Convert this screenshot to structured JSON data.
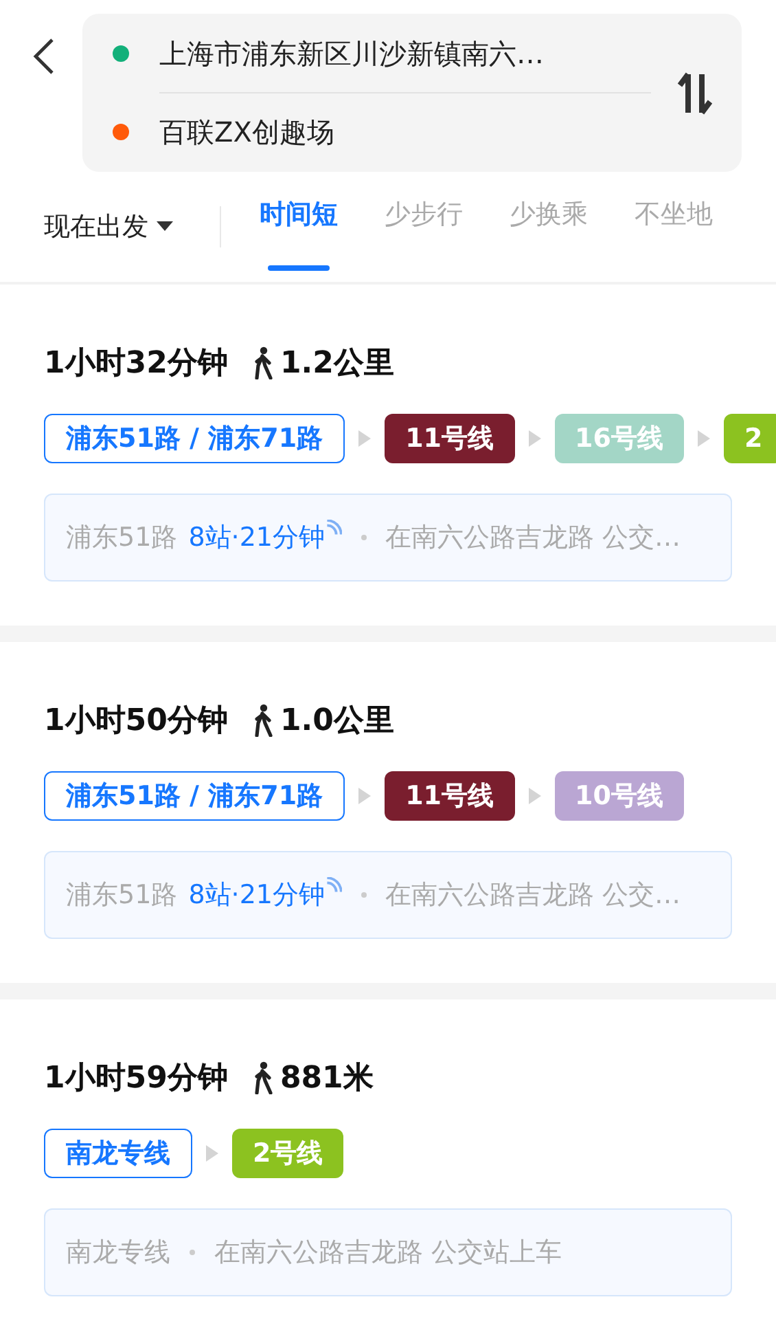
{
  "header": {
    "origin": "上海市浦东新区川沙新镇南六…",
    "destination": "百联ZX创趣场"
  },
  "departure": {
    "label": "现在出发"
  },
  "tabs": [
    {
      "label": "时间短",
      "selected": true
    },
    {
      "label": "少步行",
      "selected": false
    },
    {
      "label": "少换乘",
      "selected": false
    },
    {
      "label": "不坐地",
      "selected": false
    }
  ],
  "routes": [
    {
      "duration": "1小时32分钟",
      "walk": "1.2公里",
      "segments": [
        {
          "kind": "bus",
          "label": "浦东51路 / 浦东71路"
        },
        {
          "kind": "metro",
          "label": "11号线",
          "color": "#7a1e2e"
        },
        {
          "kind": "metro",
          "label": "16号线",
          "color": "#a3d6c6"
        },
        {
          "kind": "metro",
          "label": "2",
          "color": "#8cc220"
        }
      ],
      "detail": {
        "line": "浦东51路",
        "stops": "8站·21分钟",
        "realtime": true,
        "boarding": "在南六公路吉龙路 公交…"
      }
    },
    {
      "duration": "1小时50分钟",
      "walk": "1.0公里",
      "segments": [
        {
          "kind": "bus",
          "label": "浦东51路 / 浦东71路"
        },
        {
          "kind": "metro",
          "label": "11号线",
          "color": "#7a1e2e"
        },
        {
          "kind": "metro",
          "label": "10号线",
          "color": "#baa6d3"
        }
      ],
      "detail": {
        "line": "浦东51路",
        "stops": "8站·21分钟",
        "realtime": true,
        "boarding": "在南六公路吉龙路 公交…"
      }
    },
    {
      "duration": "1小时59分钟",
      "walk": "881米",
      "segments": [
        {
          "kind": "bus",
          "label": "南龙专线"
        },
        {
          "kind": "metro",
          "label": "2号线",
          "color": "#8cc220"
        }
      ],
      "detail": {
        "line": "南龙专线",
        "boarding": "在南六公路吉龙路 公交站上车"
      }
    }
  ]
}
